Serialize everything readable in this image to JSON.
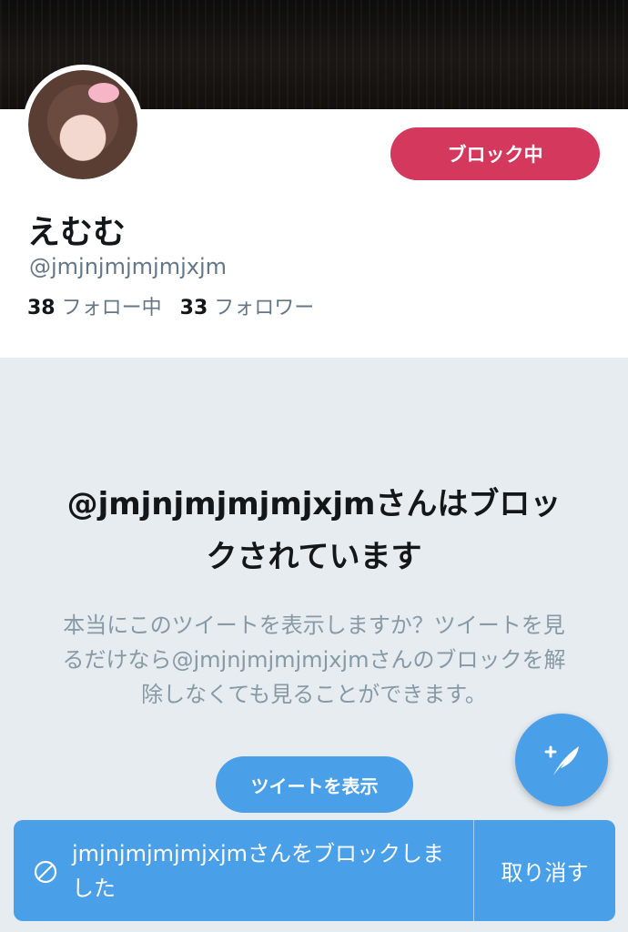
{
  "profile": {
    "display_name": "えむむ",
    "handle": "@jmjnjmjmjmjxjm",
    "block_button_label": "ブロック中",
    "following_count": "38",
    "following_label": "フォロー中",
    "followers_count": "33",
    "followers_label": "フォロワー"
  },
  "blocked_notice": {
    "title": "@jmjnjmjmjmjxjmさんはブロックされています",
    "description": "本当にこのツイートを表示しますか？ツイートを見るだけなら@jmjnjmjmjmjxjmさんのブロックを解除しなくても見ることができます。",
    "show_tweets_label": "ツイートを表示"
  },
  "toast": {
    "message": "jmjnjmjmjmjxjmさんをブロックしました",
    "undo_label": "取り消す"
  },
  "icons": {
    "compose": "compose-tweet-icon",
    "blocked": "blocked-circle-icon"
  },
  "colors": {
    "blocked_button": "#d4385c",
    "accent_blue": "#4a9fe9",
    "background": "#e6ecf0",
    "muted_text": "#657786"
  }
}
